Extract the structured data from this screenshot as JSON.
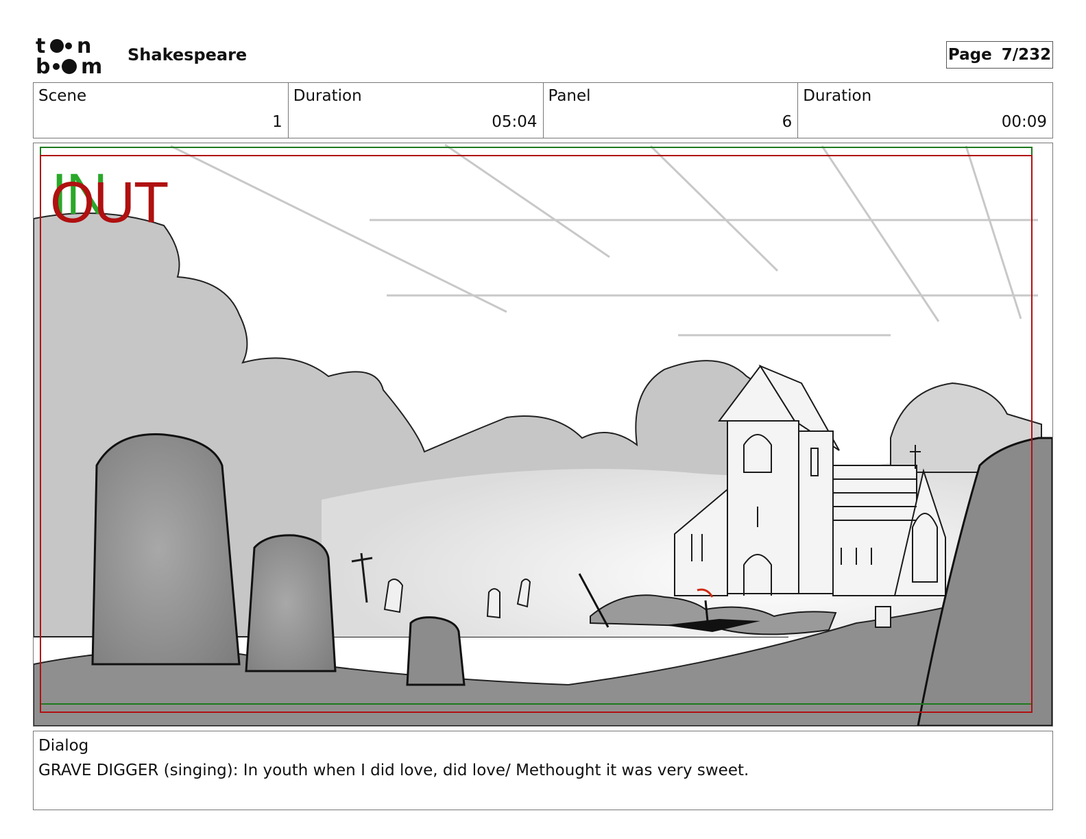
{
  "header": {
    "logo_text": "toon boom",
    "project_title": "Shakespeare",
    "page_label": "Page",
    "page_number": "7/232"
  },
  "info": {
    "scene_label": "Scene",
    "scene_value": "1",
    "scene_duration_label": "Duration",
    "scene_duration_value": "05:04",
    "panel_label": "Panel",
    "panel_value": "6",
    "panel_duration_label": "Duration",
    "panel_duration_value": "00:09"
  },
  "panel": {
    "in_marker": "IN",
    "out_marker": "OUT"
  },
  "dialog": {
    "label": "Dialog",
    "text": "GRAVE DIGGER (singing): In youth when I did love, did love/ Methought it was very sweet."
  },
  "colors": {
    "in_marker": "#2aa82a",
    "out_marker": "#b01010",
    "safe_frame_green": "#1e7a1e",
    "safe_frame_red": "#b01010",
    "border": "#777777"
  }
}
